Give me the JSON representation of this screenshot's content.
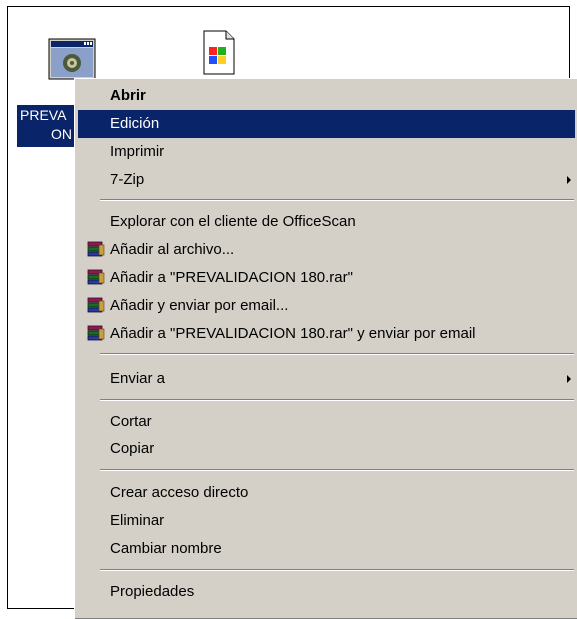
{
  "desktop": {
    "icon_label_line1": "PREVA",
    "icon_label_line2": "ON"
  },
  "menu": {
    "items": [
      {
        "label": "Abrir",
        "bold": true
      },
      {
        "label": "Edición",
        "selected": true
      },
      {
        "label": "Imprimir"
      },
      {
        "label": "7-Zip",
        "submenu": true
      },
      {
        "label": "Explorar con el cliente de OfficeScan"
      },
      {
        "label": "Añadir al archivo...",
        "icon": "winrar-icon"
      },
      {
        "label": "Añadir a \"PREVALIDACION 180.rar\"",
        "icon": "winrar-icon"
      },
      {
        "label": "Añadir y enviar por email...",
        "icon": "winrar-icon"
      },
      {
        "label": "Añadir a \"PREVALIDACION 180.rar\" y enviar por email",
        "icon": "winrar-icon"
      },
      {
        "label": "Enviar a",
        "submenu": true
      },
      {
        "label": "Cortar"
      },
      {
        "label": "Copiar"
      },
      {
        "label": "Crear acceso directo"
      },
      {
        "label": "Eliminar"
      },
      {
        "label": "Cambiar nombre"
      },
      {
        "label": "Propiedades"
      }
    ]
  },
  "colors": {
    "menu_bg": "#d4d0c8",
    "selection": "#0a246a"
  }
}
